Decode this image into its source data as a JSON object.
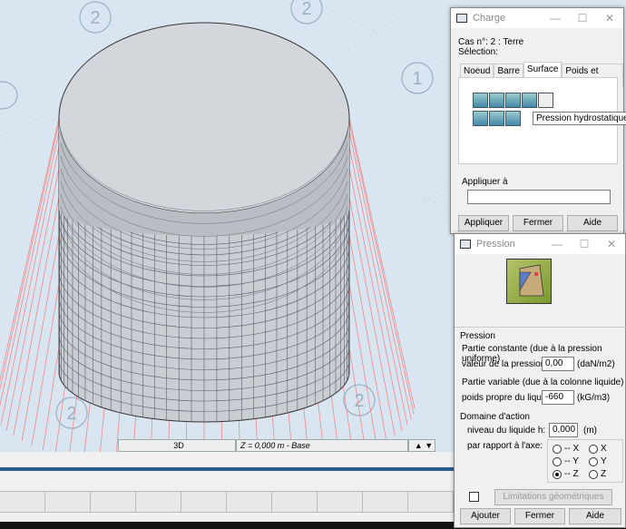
{
  "viewport": {
    "labels": [
      "2",
      "2",
      "1",
      "2",
      "2"
    ],
    "status": {
      "view": "3D",
      "level": "Z = 0,000 m - Base"
    }
  },
  "charge": {
    "title": "Charge",
    "case_line": "Cas n°: 2 : Terre",
    "selection_label": "Sélection:",
    "tabs": [
      "Noeud",
      "Barre",
      "Surface",
      "Poids et masse"
    ],
    "tooltip": "Pression hydrostatique",
    "apply_label": "Appliquer à",
    "apply_value": "",
    "buttons": {
      "apply": "Appliquer",
      "close": "Fermer",
      "help": "Aide"
    }
  },
  "pression": {
    "title": "Pression",
    "section_pression": "Pression",
    "constant_label": "Partie constante (due à la pression uniforme)",
    "pressure_value_label": "valeur de la pression",
    "pressure_value": "0,00",
    "pressure_unit": "(daN/m2)",
    "variable_label": "Partie variable (due à la colonne liquide)",
    "weight_label": "poids propre du liquide:",
    "weight_value": "-660",
    "weight_unit": "(kG/m3)",
    "domain_label": "Domaine d'action",
    "level_label": "niveau du liquide h:",
    "level_value": "0,000",
    "level_unit": "(m)",
    "axis_label": "par rapport à l'axe:",
    "radios": [
      "-- X",
      "X",
      "-- Y",
      "Y",
      "-- Z",
      "Z"
    ],
    "limitations_button": "Limitations géométriques",
    "buttons": {
      "add": "Ajouter",
      "close": "Fermer",
      "help": "Aide"
    }
  }
}
